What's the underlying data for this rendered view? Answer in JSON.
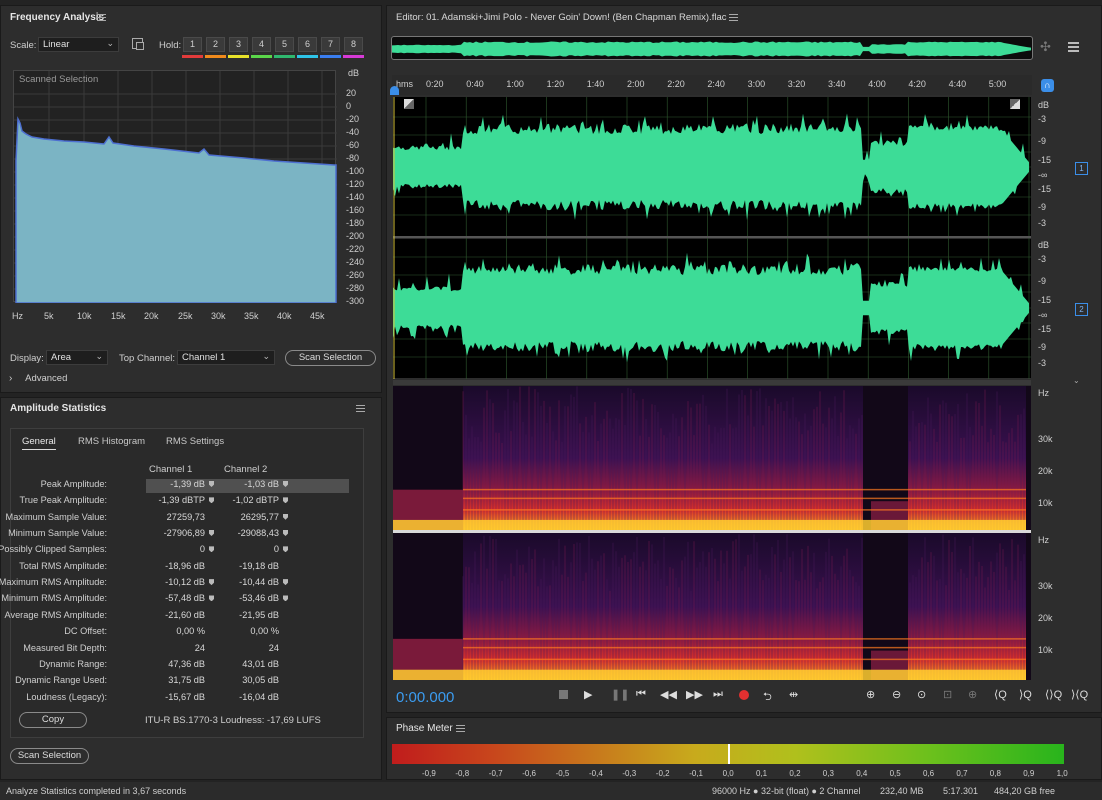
{
  "frequency_panel": {
    "title": "Frequency Analysis",
    "scale_label": "Scale:",
    "scale_value": "Linear",
    "hold_label": "Hold:",
    "hold_buttons": [
      "1",
      "2",
      "3",
      "4",
      "5",
      "6",
      "7",
      "8"
    ],
    "hold_colors": [
      "#e23b3b",
      "#f08a1c",
      "#e8e22a",
      "#5bd64a",
      "#2fb86f",
      "#2ec4e8",
      "#3a7ef0",
      "#d63ad6"
    ],
    "graph_caption": "Scanned Selection",
    "db_unit": "dB",
    "db_ticks": [
      "20",
      "0",
      "-20",
      "-40",
      "-60",
      "-80",
      "-100",
      "-120",
      "-140",
      "-160",
      "-180",
      "-200",
      "-220",
      "-240",
      "-260",
      "-280",
      "-300"
    ],
    "hz_ticks": [
      "Hz",
      "5k",
      "10k",
      "15k",
      "20k",
      "25k",
      "30k",
      "35k",
      "40k",
      "45k"
    ],
    "display_label": "Display:",
    "display_value": "Area",
    "top_channel_label": "Top Channel:",
    "top_channel_value": "Channel 1",
    "scan_button": "Scan Selection",
    "advanced": "Advanced"
  },
  "amplitude_panel": {
    "title": "Amplitude Statistics",
    "tabs": [
      "General",
      "RMS Histogram",
      "RMS Settings"
    ],
    "col_headers": [
      "Channel 1",
      "Channel 2"
    ],
    "rows": [
      {
        "label": "Peak Amplitude:",
        "c1": "-1,39 dB",
        "c2": "-1,03 dB"
      },
      {
        "label": "True Peak Amplitude:",
        "c1": "-1,39 dBTP",
        "c2": "-1,02 dBTP"
      },
      {
        "label": "Maximum Sample Value:",
        "c1": "27259,73",
        "c2": "26295,77"
      },
      {
        "label": "Minimum Sample Value:",
        "c1": "-27906,89",
        "c2": "-29088,43"
      },
      {
        "label": "Possibly Clipped Samples:",
        "c1": "0",
        "c2": "0"
      },
      {
        "label": "Total RMS Amplitude:",
        "c1": "-18,96 dB",
        "c2": "-19,18 dB"
      },
      {
        "label": "Maximum RMS Amplitude:",
        "c1": "-10,12 dB",
        "c2": "-10,44 dB"
      },
      {
        "label": "Minimum RMS Amplitude:",
        "c1": "-57,48 dB",
        "c2": "-53,46 dB"
      },
      {
        "label": "Average RMS Amplitude:",
        "c1": "-21,60 dB",
        "c2": "-21,95 dB"
      },
      {
        "label": "DC Offset:",
        "c1": "0,00 %",
        "c2": "0,00 %"
      },
      {
        "label": "Measured Bit Depth:",
        "c1": "24",
        "c2": "24"
      },
      {
        "label": "Dynamic Range:",
        "c1": "47,36 dB",
        "c2": "43,01 dB"
      },
      {
        "label": "Dynamic Range Used:",
        "c1": "31,75 dB",
        "c2": "30,05 dB"
      },
      {
        "label": "Loudness (Legacy):",
        "c1": "-15,67 dB",
        "c2": "-16,04 dB"
      }
    ],
    "markers": [
      [
        true,
        true
      ],
      [
        true,
        true
      ],
      [
        false,
        true
      ],
      [
        true,
        true
      ],
      [
        true,
        true
      ],
      [
        false,
        false
      ],
      [
        true,
        true
      ],
      [
        true,
        true
      ],
      [
        false,
        false
      ],
      [
        false,
        false
      ],
      [
        false,
        false
      ],
      [
        false,
        false
      ],
      [
        false,
        false
      ],
      [
        false,
        false
      ]
    ],
    "copy_button": "Copy",
    "loudness": "ITU-R BS.1770-3 Loudness: -17,69 LUFS",
    "scan_button": "Scan Selection"
  },
  "editor": {
    "title": "Editor: 01. Adamski+Jimi Polo - Never Goin' Down! (Ben Chapman Remix).flac",
    "time_ticks": [
      "hms",
      "0:20",
      "0:40",
      "1:00",
      "1:20",
      "1:40",
      "2:00",
      "2:20",
      "2:40",
      "3:00",
      "3:20",
      "3:40",
      "4:00",
      "4:20",
      "4:40",
      "5:00"
    ],
    "ch1_ruler": [
      "dB",
      "-3",
      "-9",
      "-15",
      "-∞",
      "-15",
      "-9",
      "-3"
    ],
    "ch2_ruler": [
      "dB",
      "-3",
      "-9",
      "-15",
      "-∞",
      "-15",
      "-9",
      "-3"
    ],
    "ch1_badge": "1",
    "ch2_badge": "2",
    "spec1_ruler": [
      "Hz",
      "30k",
      "20k",
      "10k"
    ],
    "spec2_ruler": [
      "Hz",
      "30k",
      "20k",
      "10k"
    ],
    "time_display": "0:00.000",
    "transport": [
      "stop",
      "play",
      "pause",
      "go-to-start",
      "rewind",
      "fast-forward",
      "go-to-end",
      "record",
      "loop",
      "skip-selection"
    ],
    "zoom": [
      "zoom-in-amplitude",
      "zoom-out-amplitude",
      "zoom-reset",
      "zoom-selection",
      "zoom-in-time",
      "zoom-out-time",
      "zoom-full",
      "zoom-in-point"
    ],
    "waveform_color": "#3ddc97"
  },
  "phase_meter": {
    "title": "Phase Meter",
    "ticks": [
      "-0,9",
      "-0,8",
      "-0,7",
      "-0,6",
      "-0,5",
      "-0,4",
      "-0,3",
      "-0,2",
      "-0,1",
      "0,0",
      "0,1",
      "0,2",
      "0,3",
      "0,4",
      "0,5",
      "0,6",
      "0,7",
      "0,8",
      "0,9",
      "1,0"
    ]
  },
  "status_bar": {
    "message": "Analyze Statistics completed in 3,67 seconds",
    "format": "96000 Hz ● 32-bit (float) ● 2 Channel",
    "file_size": "232,40 MB",
    "duration": "5:17.301",
    "free_space": "484,20 GB free"
  }
}
